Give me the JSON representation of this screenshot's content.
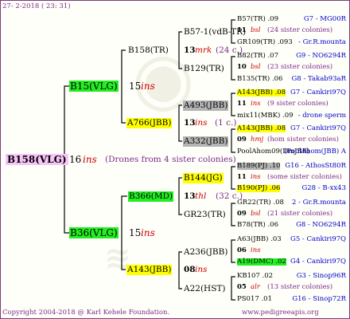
{
  "date": "27-  2-2018 ( 23: 31)",
  "copyright": "Copyright 2004-2018 @ Karl Kehele Foundation.",
  "website": "www.pedigreeapis.org",
  "root": {
    "name": "B158(VLG)",
    "year": "16",
    "suffix": "ins",
    "note": "(Drones from 4 sister colonies)"
  },
  "g1": [
    {
      "name": "B15(VLG)",
      "year": "15",
      "suffix": "ins"
    },
    {
      "name": "B36(VLG)",
      "year": "15",
      "suffix": "ins"
    }
  ],
  "g2": [
    {
      "name": "B158(TR)",
      "year": "13",
      "suffix": "mrk",
      "count": "(24 c.)"
    },
    {
      "name": "A766(JBB)",
      "year": "13",
      "suffix": "ins",
      "count": "(1 c.)"
    },
    {
      "name": "B366(MD)",
      "year": "13",
      "suffix": "thl",
      "count": "(32 c.)"
    },
    {
      "name": "A143(JBB)",
      "year": "08",
      "suffix": "ins"
    }
  ],
  "g3": [
    {
      "name": "B57-1(vdB-TR)",
      "year": "11",
      "suffix": "bsl"
    },
    {
      "name": "B129(TR)"
    },
    {
      "name": "A493(JBB)",
      "year": "11",
      "suffix": "ins"
    },
    {
      "name": "A332(JBB)"
    },
    {
      "name": "B144(JG)",
      "year": "11",
      "suffix": "ins"
    },
    {
      "name": "GR23(TR)"
    },
    {
      "name": "A236(JBB)",
      "year": "06",
      "suffix": "ins"
    },
    {
      "name": "A22(HST)",
      "year": "05",
      "suffix": "alr"
    }
  ],
  "g4": [
    {
      "name": "B57(TR) .09",
      "right": "G7 - MG00R"
    },
    {
      "name": "11",
      "suffix": "bsl",
      "count": "(24 sister colonies)"
    },
    {
      "name": "GR109(TR) .093",
      "right": "- Gr.R.mounta"
    },
    {
      "name": "B82(TR) .07",
      "right": "G9 - NO6294R"
    },
    {
      "name": "10",
      "suffix": "bsl",
      "count": "(23 sister colonies)"
    },
    {
      "name": "B135(TR) .06",
      "right": "G8 - Takab93aR"
    },
    {
      "name": "A143(JBB) .08",
      "right": "G7 - Cankiri97Q"
    },
    {
      "name": "11",
      "suffix": "ins",
      "count": "(9 sister colonies)"
    },
    {
      "name": "mix11(MBK) .09",
      "right": "- drone sperm"
    },
    {
      "name": "A143(JBB) .08",
      "right": "G7 - Cankiri97Q"
    },
    {
      "name": "09",
      "suffix": "hmj",
      "count": "(hom sister colonies)"
    },
    {
      "name": "PoolAhom09(DmJBB)",
      "right": "(PoolAhom(JBB) A"
    },
    {
      "name": "B189(PJ) .10",
      "right": "G16 - AthosSt80R"
    },
    {
      "name": "11",
      "suffix": "ins",
      "count": "(some sister colonies)"
    },
    {
      "name": "B190(PJ) .06",
      "right": "G28 - B-xx43"
    },
    {
      "name": "GR22(TR) .08",
      "right": "2 - Gr.R.mounta"
    },
    {
      "name": "09",
      "suffix": "bsl",
      "count": "(21 sister colonies)"
    },
    {
      "name": "B78(TR) .06",
      "right": "G8 - NO6294R"
    },
    {
      "name": "A63(JBB) .03",
      "right": "G5 - Cankiri97Q"
    },
    {
      "name": "06",
      "suffix": "ins"
    },
    {
      "name": "A19(DMC) .02",
      "right": "G4 - Cankiri97Q"
    },
    {
      "name": "KB107 .02",
      "right": "G3 - Sinop96R"
    },
    {
      "name": "05",
      "suffix": "alr",
      "count": "(13 sister colonies)"
    },
    {
      "name": "PS017 .01",
      "right": "G16 - Sinop72R"
    }
  ]
}
